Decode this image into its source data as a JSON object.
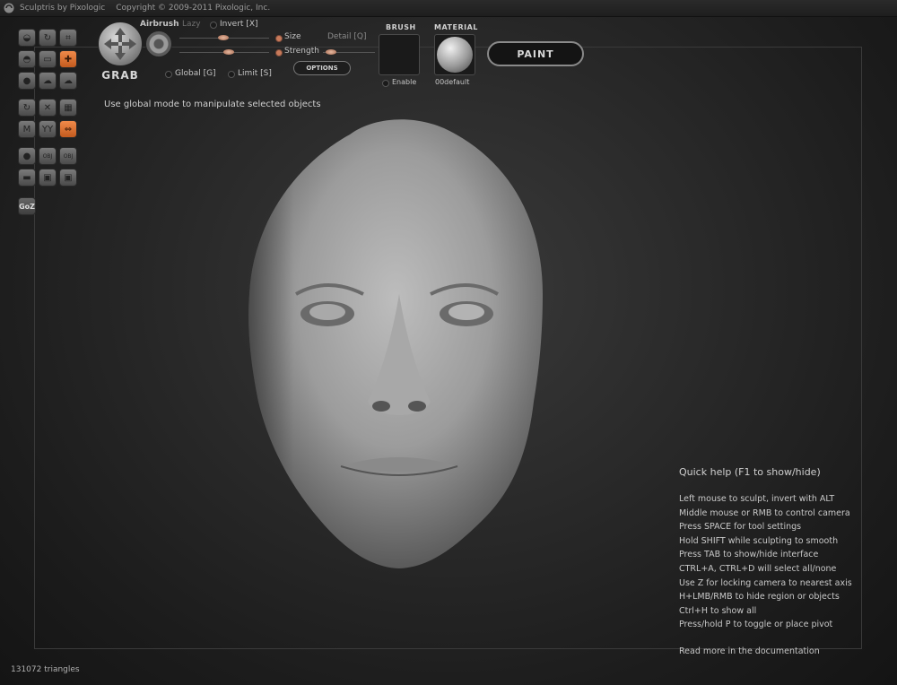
{
  "titlebar": {
    "app": "Sculptris by Pixologic",
    "copyright": "Copyright © 2009-2011 Pixologic, Inc."
  },
  "toolbar": {
    "grab_label": "GRAB",
    "airbrush_label": "Airbrush",
    "lazy_label": "Lazy",
    "invert_label": "Invert [X]",
    "size_label": "Size",
    "detail_label": "Detail [Q]",
    "strength_label": "Strength",
    "options_label": "OPTIONS",
    "global_label": "Global [G]",
    "limit_label": "Limit [S]",
    "brush_header": "BRUSH",
    "enable_label": "Enable",
    "material_header": "MATERIAL",
    "material_name": "00default",
    "paint_label": "PAINT"
  },
  "tools": [
    {
      "name": "draw-tool",
      "icon": "◒"
    },
    {
      "name": "rotate-tool",
      "icon": "↻"
    },
    {
      "name": "crop-tool",
      "icon": "⌗"
    },
    {
      "name": "inflate-tool",
      "icon": "◓"
    },
    {
      "name": "flatten-tool",
      "icon": "▭"
    },
    {
      "name": "grab-tool",
      "icon": "✚"
    },
    {
      "name": "pinch-tool",
      "icon": "●"
    },
    {
      "name": "smooth-tool",
      "icon": "☁"
    },
    {
      "name": "crease-tool",
      "icon": "☁"
    },
    {
      "name": "reduce-tool",
      "icon": "↻"
    },
    {
      "name": "symmetry-tool",
      "icon": "✕"
    },
    {
      "name": "grid-tool",
      "icon": "▦"
    },
    {
      "name": "wireframe-tool",
      "icon": "M"
    },
    {
      "name": "mirror-tool",
      "icon": "YY"
    },
    {
      "name": "move-axis-tool",
      "icon": "⇔"
    },
    {
      "name": "sphere-tool",
      "icon": "●"
    },
    {
      "name": "import-obj-tool",
      "icon": "OBJ"
    },
    {
      "name": "export-obj-tool",
      "icon": "OBJ"
    },
    {
      "name": "plane-tool",
      "icon": "▬"
    },
    {
      "name": "save-tool",
      "icon": "▣"
    },
    {
      "name": "save-as-tool",
      "icon": "▣"
    }
  ],
  "goz_label": "GoZ",
  "hint": "Use global mode to manipulate selected objects",
  "quick_help": {
    "title": "Quick help (F1 to show/hide)",
    "lines": [
      "Left mouse to sculpt, invert with ALT",
      "Middle mouse or RMB to control camera",
      "Press SPACE for tool settings",
      "Hold SHIFT while sculpting to smooth",
      "Press TAB to show/hide interface",
      "CTRL+A, CTRL+D will select all/none",
      "Use Z for locking camera to nearest axis",
      "H+LMB/RMB to hide region or objects",
      "Ctrl+H to show all",
      "Press/hold P to toggle or place pivot"
    ],
    "more": "Read more in the documentation"
  },
  "status": {
    "triangles": "131072 triangles"
  },
  "colors": {
    "accent": "#e07a3a",
    "background": "#262626"
  }
}
